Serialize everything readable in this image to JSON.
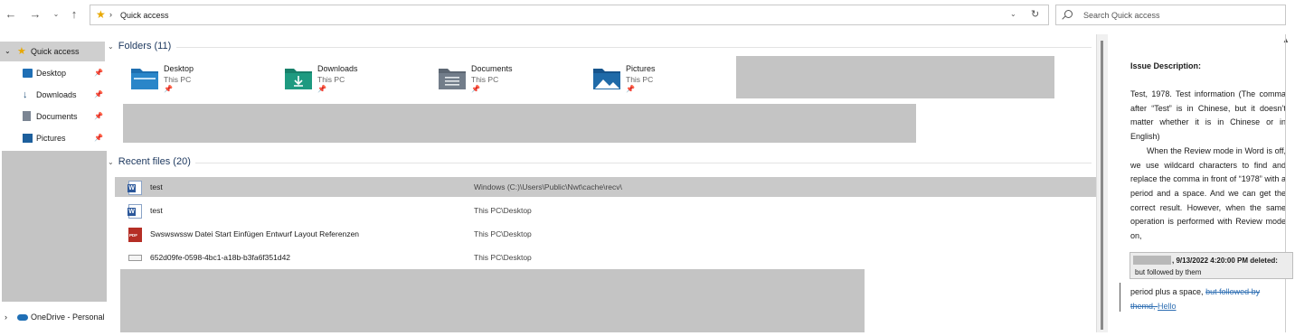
{
  "address": {
    "path": "Quick access",
    "separator": "›"
  },
  "search": {
    "placeholder": "Search Quick access"
  },
  "sidebar": {
    "quick_access": "Quick access",
    "items": [
      {
        "label": "Desktop",
        "icon": "desktop-icon"
      },
      {
        "label": "Downloads",
        "icon": "download-icon"
      },
      {
        "label": "Documents",
        "icon": "documents-icon"
      },
      {
        "label": "Pictures",
        "icon": "pictures-icon"
      }
    ],
    "onedrive": "OneDrive - Personal"
  },
  "folders": {
    "header": "Folders (11)",
    "items": [
      {
        "name": "Desktop",
        "location": "This PC"
      },
      {
        "name": "Downloads",
        "location": "This PC"
      },
      {
        "name": "Documents",
        "location": "This PC"
      },
      {
        "name": "Pictures",
        "location": "This PC"
      }
    ]
  },
  "recent": {
    "header": "Recent files (20)",
    "rows": [
      {
        "name": "test",
        "location": "Windows (C:)\\Users\\Public\\Nwt\\cache\\recv\\",
        "icon": "word-icon",
        "selected": true
      },
      {
        "name": "test",
        "location": "This PC\\Desktop",
        "icon": "word-icon",
        "selected": false
      },
      {
        "name": "Swswswssw  Datei Start Einfügen Entwurf Layout Referenzen",
        "location": "This PC\\Desktop",
        "icon": "pdf-icon",
        "selected": false
      },
      {
        "name": "652d09fe-0598-4bc1-a18b-b3fa6f351d42",
        "location": "This PC\\Desktop",
        "icon": "file-icon",
        "selected": false
      }
    ]
  },
  "preview": {
    "title": "Issue Description:",
    "para1": "Test, 1978. Test information (The comma after “Test” is in Chinese, but it doesn’t matter whether it is in Chinese or in English)",
    "para2": "When the Review mode in Word is off, we use wildcard characters to find and replace the comma in front of “1978” with a period and a space. And we can get the correct result. However, when the same operation is performed with Review mode on,",
    "balloon_title": ", 9/13/2022 4:20:00 PM deleted:",
    "balloon_deleted": "but followed by them",
    "tail_text": "period plus a space, ",
    "tail_deleted": "but followed by themd",
    "tail_comma": ", ",
    "tail_inserted": "Hello"
  },
  "colors": {
    "selected_row": "#c9c9c9",
    "redaction": "#c4c4c4",
    "revision": "#2f6fb3",
    "star": "#e8a800"
  }
}
